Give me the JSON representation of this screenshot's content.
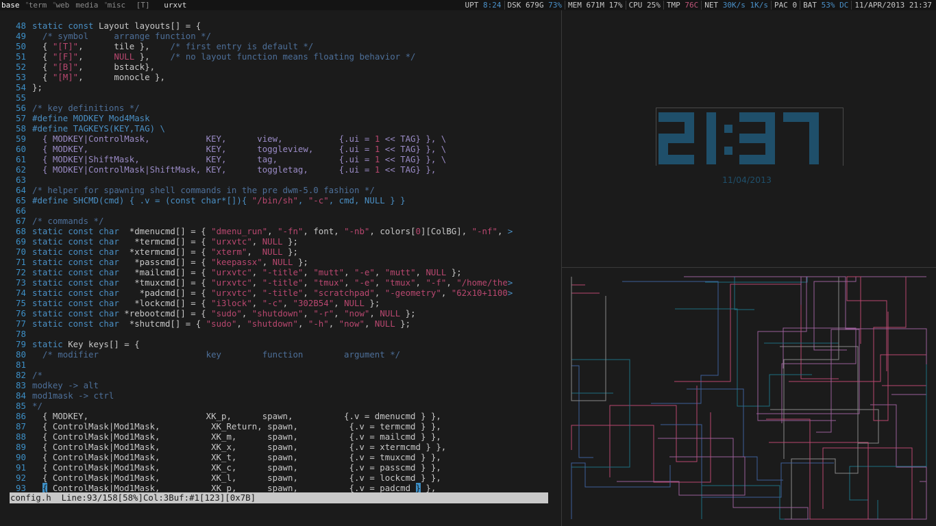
{
  "topbar": {
    "tags": [
      {
        "label": "base",
        "active": true,
        "sup": ""
      },
      {
        "label": "term",
        "active": false,
        "sup": "•"
      },
      {
        "label": "web",
        "active": false,
        "sup": "•"
      },
      {
        "label": "media",
        "active": false,
        "sup": ""
      },
      {
        "label": "misc",
        "active": false,
        "sup": "•"
      }
    ],
    "layout_symbol": "[T]",
    "window_title": "urxvt",
    "status": [
      {
        "label": "UPT",
        "values": [
          {
            "text": "8:24",
            "color": "#4a90c8"
          }
        ]
      },
      {
        "label": "DSK",
        "values": [
          {
            "text": "679G",
            "color": "#c8c8c8"
          },
          {
            "text": "73%",
            "color": "#4a90c8"
          }
        ]
      },
      {
        "label": "MEM",
        "values": [
          {
            "text": "671M",
            "color": "#c8c8c8"
          },
          {
            "text": "17%",
            "color": "#c8c8c8"
          }
        ]
      },
      {
        "label": "CPU",
        "values": [
          {
            "text": "25%",
            "color": "#c8c8c8"
          }
        ]
      },
      {
        "label": "TMP",
        "values": [
          {
            "text": "76C",
            "color": "#c0567a"
          }
        ]
      },
      {
        "label": "NET",
        "values": [
          {
            "text": "30K/s",
            "color": "#4a90c8"
          },
          {
            "text": "1K/s",
            "color": "#4a90c8"
          }
        ]
      },
      {
        "label": "PAC",
        "values": [
          {
            "text": "0",
            "color": "#c8c8c8"
          }
        ]
      },
      {
        "label": "BAT",
        "values": [
          {
            "text": "53%",
            "color": "#4a90c8"
          },
          {
            "text": "DC",
            "color": "#4a90c8"
          }
        ]
      },
      {
        "label": "",
        "values": [
          {
            "text": "11/APR/2013 21:37",
            "color": "#c8c8c8"
          }
        ]
      }
    ]
  },
  "editor": {
    "lines": [
      {
        "n": "48",
        "t": [
          [
            "kw",
            "static const "
          ],
          [
            "id",
            "Layout layouts[] = {"
          ]
        ]
      },
      {
        "n": "49",
        "t": [
          [
            "id",
            "  "
          ],
          [
            "cm",
            "/* symbol     arrange function */"
          ]
        ]
      },
      {
        "n": "50",
        "t": [
          [
            "id",
            "  { "
          ],
          [
            "str",
            "\"[T]\""
          ],
          [
            "id",
            ",      tile },    "
          ],
          [
            "cm",
            "/* first entry is default */"
          ]
        ]
      },
      {
        "n": "51",
        "t": [
          [
            "id",
            "  { "
          ],
          [
            "str",
            "\"[F]\""
          ],
          [
            "id",
            ",      "
          ],
          [
            "num",
            "NULL"
          ],
          [
            "id",
            " },    "
          ],
          [
            "cm",
            "/* no layout function means floating behavior */"
          ]
        ]
      },
      {
        "n": "52",
        "t": [
          [
            "id",
            "  { "
          ],
          [
            "str",
            "\"[B]\""
          ],
          [
            "id",
            ",      bstack},"
          ]
        ]
      },
      {
        "n": "53",
        "t": [
          [
            "id",
            "  { "
          ],
          [
            "str",
            "\"[M]\""
          ],
          [
            "id",
            ",      monocle },"
          ]
        ]
      },
      {
        "n": "54",
        "t": [
          [
            "id",
            "};"
          ]
        ]
      },
      {
        "n": "55",
        "t": [
          [
            "id",
            ""
          ]
        ]
      },
      {
        "n": "56",
        "t": [
          [
            "cm",
            "/* key definitions */"
          ]
        ]
      },
      {
        "n": "57",
        "t": [
          [
            "pp",
            "#define MODKEY Mod4Mask"
          ]
        ]
      },
      {
        "n": "58",
        "t": [
          [
            "pp",
            "#define TAGKEYS(KEY,TAG) \\"
          ]
        ]
      },
      {
        "n": "59",
        "t": [
          [
            "mac",
            "  { MODKEY|ControlMask,           KEY,      view,           {.ui = "
          ],
          [
            "num",
            "1"
          ],
          [
            "mac",
            " << TAG} }, \\"
          ]
        ]
      },
      {
        "n": "60",
        "t": [
          [
            "mac",
            "  { MODKEY,                       KEY,      toggleview,     {.ui = "
          ],
          [
            "num",
            "1"
          ],
          [
            "mac",
            " << TAG} }, \\"
          ]
        ]
      },
      {
        "n": "61",
        "t": [
          [
            "mac",
            "  { MODKEY|ShiftMask,             KEY,      tag,            {.ui = "
          ],
          [
            "num",
            "1"
          ],
          [
            "mac",
            " << TAG} }, \\"
          ]
        ]
      },
      {
        "n": "62",
        "t": [
          [
            "mac",
            "  { MODKEY|ControlMask|ShiftMask, KEY,      toggletag,      {.ui = "
          ],
          [
            "num",
            "1"
          ],
          [
            "mac",
            " << TAG} },"
          ]
        ]
      },
      {
        "n": "63",
        "t": [
          [
            "id",
            ""
          ]
        ]
      },
      {
        "n": "64",
        "t": [
          [
            "cm",
            "/* helper for spawning shell commands in the pre dwm-5.0 fashion */"
          ]
        ]
      },
      {
        "n": "65",
        "t": [
          [
            "pp",
            "#define SHCMD(cmd) { .v = (const char*[]){ "
          ],
          [
            "str",
            "\"/bin/sh\""
          ],
          [
            "pp",
            ", "
          ],
          [
            "str",
            "\"-c\""
          ],
          [
            "pp",
            ", cmd, NULL } }"
          ]
        ]
      },
      {
        "n": "66",
        "t": [
          [
            "id",
            ""
          ]
        ]
      },
      {
        "n": "67",
        "t": [
          [
            "cm",
            "/* commands */"
          ]
        ]
      },
      {
        "n": "68",
        "t": [
          [
            "kw",
            "static const char  "
          ],
          [
            "id",
            "*dmenucmd[] = { "
          ],
          [
            "str",
            "\"dmenu_run\""
          ],
          [
            "id",
            ", "
          ],
          [
            "str",
            "\"-fn\""
          ],
          [
            "id",
            ", font, "
          ],
          [
            "str",
            "\"-nb\""
          ],
          [
            "id",
            ", colors["
          ],
          [
            "num",
            "0"
          ],
          [
            "id",
            "][ColBG], "
          ],
          [
            "str",
            "\"-nf\""
          ],
          [
            "id",
            ", "
          ],
          [
            "kw",
            ">"
          ]
        ]
      },
      {
        "n": "69",
        "t": [
          [
            "kw",
            "static const char   "
          ],
          [
            "id",
            "*termcmd[] = { "
          ],
          [
            "str",
            "\"urxvtc\""
          ],
          [
            "id",
            ", "
          ],
          [
            "num",
            "NULL"
          ],
          [
            "id",
            " };"
          ]
        ]
      },
      {
        "n": "70",
        "t": [
          [
            "kw",
            "static const char  "
          ],
          [
            "id",
            "*xtermcmd[] = { "
          ],
          [
            "str",
            "\"xterm\""
          ],
          [
            "id",
            ",  "
          ],
          [
            "num",
            "NULL"
          ],
          [
            "id",
            " };"
          ]
        ]
      },
      {
        "n": "71",
        "t": [
          [
            "kw",
            "static const char   "
          ],
          [
            "id",
            "*passcmd[] = { "
          ],
          [
            "str",
            "\"keepassx\""
          ],
          [
            "id",
            ", "
          ],
          [
            "num",
            "NULL"
          ],
          [
            "id",
            " };"
          ]
        ]
      },
      {
        "n": "72",
        "t": [
          [
            "kw",
            "static const char   "
          ],
          [
            "id",
            "*mailcmd[] = { "
          ],
          [
            "str",
            "\"urxvtc\""
          ],
          [
            "id",
            ", "
          ],
          [
            "str",
            "\"-title\""
          ],
          [
            "id",
            ", "
          ],
          [
            "str",
            "\"mutt\""
          ],
          [
            "id",
            ", "
          ],
          [
            "str",
            "\"-e\""
          ],
          [
            "id",
            ", "
          ],
          [
            "str",
            "\"mutt\""
          ],
          [
            "id",
            ", "
          ],
          [
            "num",
            "NULL"
          ],
          [
            "id",
            " };"
          ]
        ]
      },
      {
        "n": "73",
        "t": [
          [
            "kw",
            "static const char   "
          ],
          [
            "id",
            "*tmuxcmd[] = { "
          ],
          [
            "str",
            "\"urxvtc\""
          ],
          [
            "id",
            ", "
          ],
          [
            "str",
            "\"-title\""
          ],
          [
            "id",
            ", "
          ],
          [
            "str",
            "\"tmux\""
          ],
          [
            "id",
            ", "
          ],
          [
            "str",
            "\"-e\""
          ],
          [
            "id",
            ", "
          ],
          [
            "str",
            "\"tmux\""
          ],
          [
            "id",
            ", "
          ],
          [
            "str",
            "\"-f\""
          ],
          [
            "id",
            ", "
          ],
          [
            "str",
            "\"/home/the"
          ],
          [
            "kw",
            ">"
          ]
        ]
      },
      {
        "n": "74",
        "t": [
          [
            "kw",
            "static const char    "
          ],
          [
            "id",
            "*padcmd[] = { "
          ],
          [
            "str",
            "\"urxvtc\""
          ],
          [
            "id",
            ", "
          ],
          [
            "str",
            "\"-title\""
          ],
          [
            "id",
            ", "
          ],
          [
            "str",
            "\"scratchpad\""
          ],
          [
            "id",
            ", "
          ],
          [
            "str",
            "\"-geometry\""
          ],
          [
            "id",
            ", "
          ],
          [
            "str",
            "\"62x10+1100"
          ],
          [
            "kw",
            ">"
          ]
        ]
      },
      {
        "n": "75",
        "t": [
          [
            "kw",
            "static const char   "
          ],
          [
            "id",
            "*lockcmd[] = { "
          ],
          [
            "str",
            "\"i3lock\""
          ],
          [
            "id",
            ", "
          ],
          [
            "str",
            "\"-c\""
          ],
          [
            "id",
            ", "
          ],
          [
            "str",
            "\"302B54\""
          ],
          [
            "id",
            ", "
          ],
          [
            "num",
            "NULL"
          ],
          [
            "id",
            " };"
          ]
        ]
      },
      {
        "n": "76",
        "t": [
          [
            "kw",
            "static const char "
          ],
          [
            "id",
            "*rebootcmd[] = { "
          ],
          [
            "str",
            "\"sudo\""
          ],
          [
            "id",
            ", "
          ],
          [
            "str",
            "\"shutdown\""
          ],
          [
            "id",
            ", "
          ],
          [
            "str",
            "\"-r\""
          ],
          [
            "id",
            ", "
          ],
          [
            "str",
            "\"now\""
          ],
          [
            "id",
            ", "
          ],
          [
            "num",
            "NULL"
          ],
          [
            "id",
            " };"
          ]
        ]
      },
      {
        "n": "77",
        "t": [
          [
            "kw",
            "static const char  "
          ],
          [
            "id",
            "*shutcmd[] = { "
          ],
          [
            "str",
            "\"sudo\""
          ],
          [
            "id",
            ", "
          ],
          [
            "str",
            "\"shutdown\""
          ],
          [
            "id",
            ", "
          ],
          [
            "str",
            "\"-h\""
          ],
          [
            "id",
            ", "
          ],
          [
            "str",
            "\"now\""
          ],
          [
            "id",
            ", "
          ],
          [
            "num",
            "NULL"
          ],
          [
            "id",
            " };"
          ]
        ]
      },
      {
        "n": "78",
        "t": [
          [
            "id",
            ""
          ]
        ]
      },
      {
        "n": "79",
        "t": [
          [
            "kw",
            "static "
          ],
          [
            "id",
            "Key keys[] = {"
          ]
        ]
      },
      {
        "n": "80",
        "t": [
          [
            "id",
            "  "
          ],
          [
            "cm",
            "/* modifier                     key        function        argument */"
          ]
        ]
      },
      {
        "n": "81",
        "t": [
          [
            "id",
            ""
          ]
        ]
      },
      {
        "n": "82",
        "t": [
          [
            "cm",
            "/*"
          ]
        ]
      },
      {
        "n": "83",
        "t": [
          [
            "cm",
            "modkey -> alt"
          ]
        ]
      },
      {
        "n": "84",
        "t": [
          [
            "cm",
            "mod1mask -> ctrl"
          ]
        ]
      },
      {
        "n": "85",
        "t": [
          [
            "cm",
            "*/"
          ]
        ]
      },
      {
        "n": "86",
        "t": [
          [
            "id",
            "  { MODKEY,                       XK_p,      spawn,          {.v = dmenucmd } },"
          ]
        ]
      },
      {
        "n": "87",
        "t": [
          [
            "id",
            "  { ControlMask|Mod1Mask,          XK_Return, spawn,          {.v = termcmd } },"
          ]
        ]
      },
      {
        "n": "88",
        "t": [
          [
            "id",
            "  { ControlMask|Mod1Mask,          XK_m,      spawn,          {.v = mailcmd } },"
          ]
        ]
      },
      {
        "n": "89",
        "t": [
          [
            "id",
            "  { ControlMask|Mod1Mask,          XK_x,      spawn,          {.v = xtermcmd } },"
          ]
        ]
      },
      {
        "n": "90",
        "t": [
          [
            "id",
            "  { ControlMask|Mod1Mask,          XK_t,      spawn,          {.v = tmuxcmd } },"
          ]
        ]
      },
      {
        "n": "91",
        "t": [
          [
            "id",
            "  { ControlMask|Mod1Mask,          XK_c,      spawn,          {.v = passcmd } },"
          ]
        ]
      },
      {
        "n": "92",
        "t": [
          [
            "id",
            "  { ControlMask|Mod1Mask,          XK_l,      spawn,          {.v = lockcmd } },"
          ]
        ]
      },
      {
        "n": "93",
        "t": [
          [
            "id",
            "  "
          ],
          [
            "cur",
            "{"
          ],
          [
            "id",
            " ControlMask|Mod1Mask,          XK_p,      spawn,          {.v = padcmd "
          ],
          [
            "cur",
            "}"
          ],
          [
            "id",
            " },"
          ]
        ]
      }
    ],
    "statusline": "config.h  Line:93/158[58%]Col:3Buf:#1[123][0x7B]"
  },
  "clock": {
    "time": "21:37",
    "date": "11/04/2013",
    "color": "#1f4f6a"
  },
  "pipes": {
    "colors": [
      "#1e6f80",
      "#b8476f",
      "#8a8a8a",
      "#3d5f99",
      "#9a5f99"
    ]
  }
}
